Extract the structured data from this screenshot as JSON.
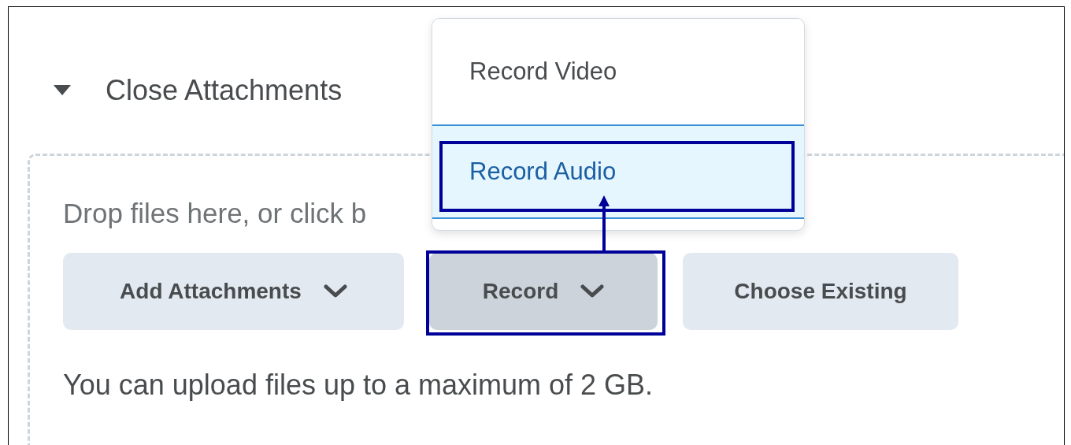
{
  "section": {
    "label": "Close Attachments",
    "expanded": true
  },
  "drop_zone": {
    "hint": "Drop files here, or click b",
    "buttons": [
      {
        "label": "Add Attachments",
        "has_menu": true,
        "pressed": false,
        "highlighted": false
      },
      {
        "label": "Record",
        "has_menu": true,
        "pressed": true,
        "highlighted": true
      },
      {
        "label": "Choose Existing",
        "has_menu": false,
        "pressed": false,
        "highlighted": false
      }
    ],
    "note": "You can upload files up to a maximum of 2 GB."
  },
  "record_menu": {
    "items": [
      {
        "label": "Record Video",
        "selected": false,
        "highlighted": false
      },
      {
        "label": "Record Audio",
        "selected": true,
        "highlighted": true
      }
    ]
  }
}
